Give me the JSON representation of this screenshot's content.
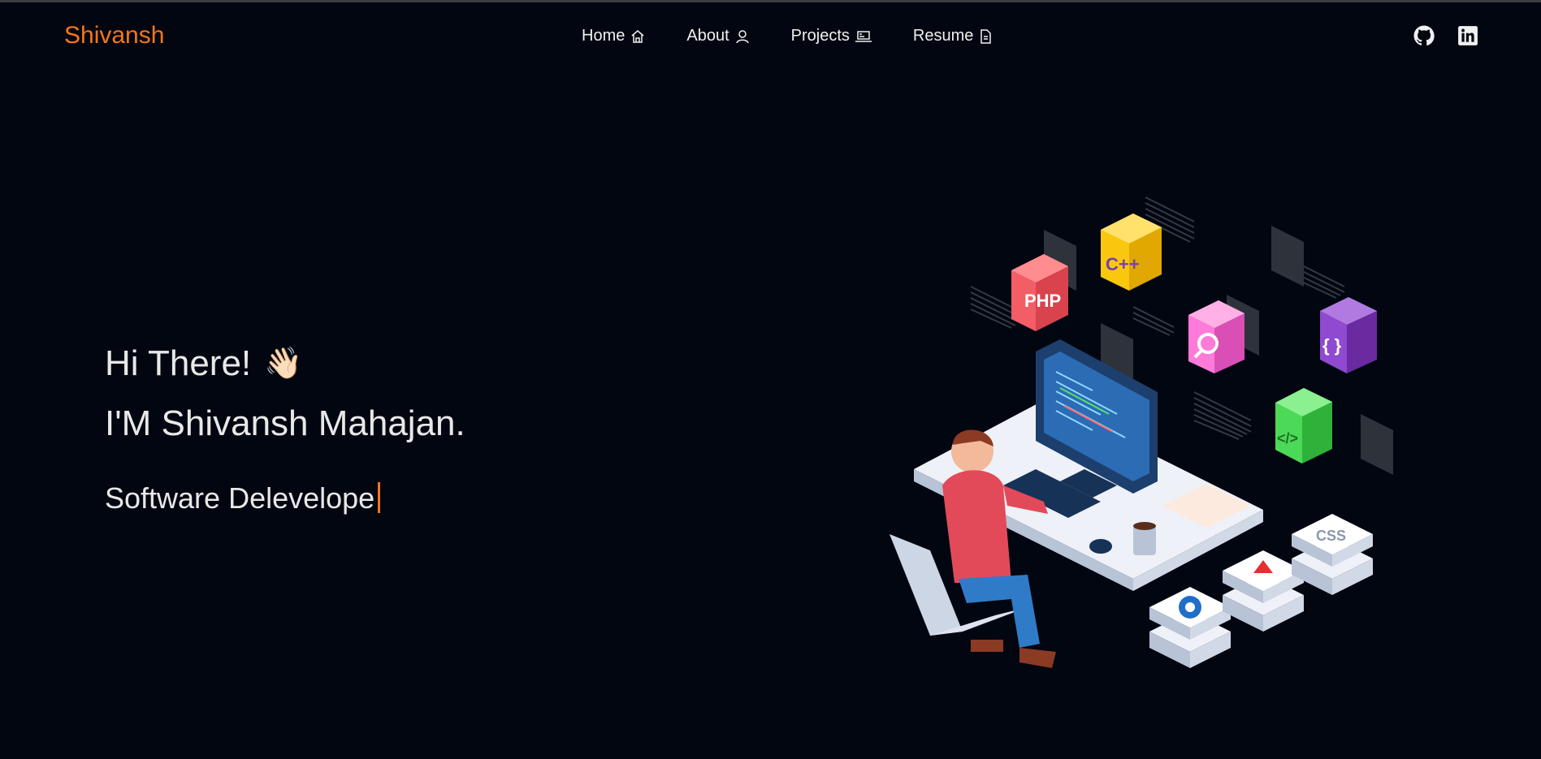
{
  "navbar": {
    "brand": "Shivansh",
    "links": [
      {
        "label": "Home",
        "icon": "home-icon"
      },
      {
        "label": "About",
        "icon": "user-icon"
      },
      {
        "label": "Projects",
        "icon": "laptop-icon"
      },
      {
        "label": "Resume",
        "icon": "document-icon"
      }
    ],
    "social": [
      {
        "icon": "github-icon"
      },
      {
        "icon": "linkedin-icon"
      }
    ]
  },
  "hero": {
    "greeting": "Hi There!",
    "wave": "👋🏻",
    "name": "I'M Shivansh Mahajan.",
    "role_typed": "Software Delevelope"
  },
  "illustration": {
    "tiles": [
      "PHP",
      "C++",
      "{ }",
      "</>",
      "CSS"
    ]
  },
  "colors": {
    "background": "#010611",
    "accent": "#f5761a",
    "text": "#e8e8e8"
  }
}
